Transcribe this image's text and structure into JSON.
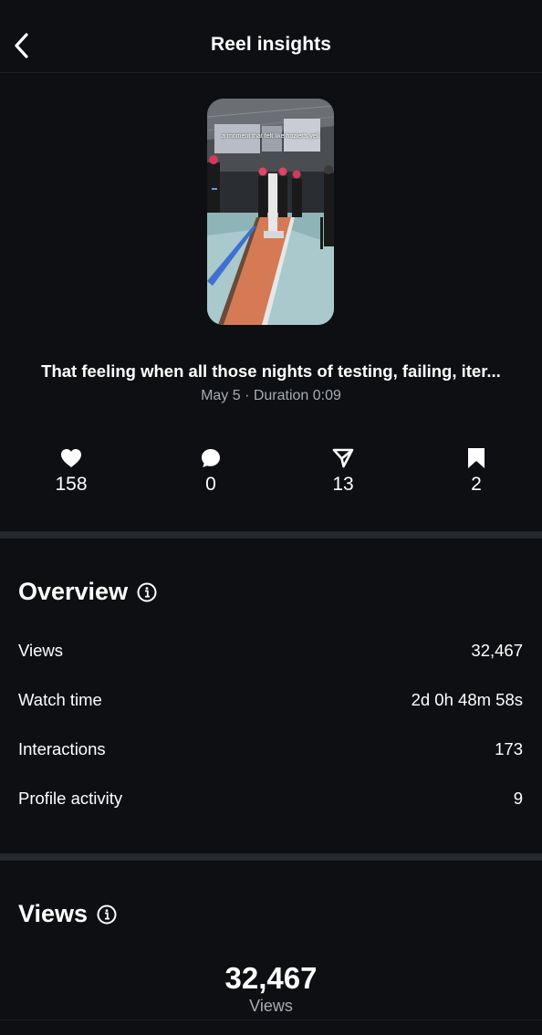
{
  "header": {
    "title": "Reel insights"
  },
  "reel": {
    "thumbnail_caption": "a moment that felt like hozier's yell",
    "caption": "That feeling when all those nights of testing, failing, iter...",
    "meta": "May 5 · Duration 0:09"
  },
  "stats": {
    "likes": "158",
    "comments": "0",
    "shares": "13",
    "saves": "2"
  },
  "overview": {
    "title": "Overview",
    "rows": [
      {
        "label": "Views",
        "value": "32,467"
      },
      {
        "label": "Watch time",
        "value": "2d 0h 48m 58s"
      },
      {
        "label": "Interactions",
        "value": "173"
      },
      {
        "label": "Profile activity",
        "value": "9"
      }
    ]
  },
  "views": {
    "title": "Views",
    "total": "32,467",
    "label": "Views"
  },
  "icons": {
    "back": "chevron-left-icon",
    "like": "heart-icon",
    "comment": "comment-bubble-icon",
    "share": "send-icon",
    "save": "bookmark-icon",
    "info": "info-icon"
  },
  "colors": {
    "background": "#0d0f12",
    "divider": "#25282d",
    "muted_text": "#a8acb3"
  }
}
